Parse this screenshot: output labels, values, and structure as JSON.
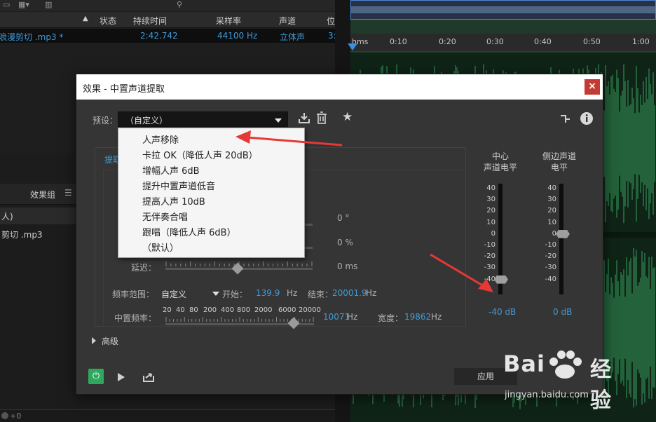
{
  "files_panel": {
    "columns": [
      "状态",
      "持续时间",
      "采样率",
      "声道",
      "位"
    ],
    "file_row": {
      "name": "浪漫剪切 .mp3 *",
      "duration": "2:42.742",
      "sample_rate": "44100 Hz",
      "channels": "立体声",
      "bits": "3:"
    },
    "effects_tab": "效果组",
    "rack_rows": [
      "人)",
      "剪切 .mp3"
    ],
    "bottom_value": "+0"
  },
  "timeline": {
    "ruler_labels": [
      "hms",
      "0:10",
      "0:20",
      "0:30",
      "0:40",
      "0:50",
      "1:00"
    ]
  },
  "dialog": {
    "title": "效果 - 中置声道提取",
    "close_label": "×",
    "preset_label": "预设：",
    "preset_value": "（自定义）",
    "preset_options": [
      "人声移除",
      "卡拉 OK（降低人声 20dB）",
      "增幅人声 6dB",
      "提升中置声道低音",
      "提高人声 10dB",
      "无伴奏合唱",
      "跟唱（降低人声 6dB）",
      "（默认）"
    ],
    "tab_label": "提取",
    "rows": {
      "phase_value": "0 °",
      "pan_value": "0 %",
      "delay_label": "延迟：",
      "delay_value": "0 ms",
      "freq_range_label": "频率范围：",
      "freq_range_value": "自定义",
      "start_label": "开始：",
      "start_value": "139.9",
      "start_unit": "Hz",
      "end_label": "结束：",
      "end_value": "20001.9",
      "end_unit": "Hz",
      "center_freq_label": "中置频率：",
      "center_freq_value": "10071",
      "center_freq_unit": "Hz",
      "width_label": "宽度：",
      "width_value": "19862",
      "width_unit": "Hz",
      "freq_scale": [
        "20",
        "40",
        "80",
        "200",
        "400",
        "800",
        "2000",
        "6000",
        "20000"
      ]
    },
    "meters": {
      "center": {
        "title_line1": "中心",
        "title_line2": "声道电平",
        "value": "-40 dB",
        "level_db": -40
      },
      "side": {
        "title_line1": "侧边声道",
        "title_line2": "电平",
        "value": "0 dB",
        "level_db": 0
      },
      "scale": [
        "40",
        "30",
        "20",
        "10",
        "0",
        "-10",
        "-20",
        "-30",
        "-40"
      ]
    },
    "advanced_label": "高级",
    "apply_label": "应用"
  },
  "watermark": {
    "brand": "Bai",
    "brand2": "经验",
    "url": "jingyan.baidu.com"
  },
  "colors": {
    "accent_blue": "#3f9bd8",
    "close_red": "#c33b33",
    "power_green": "#2fa85e",
    "annotation_red": "#e53935",
    "waveform_green": "#2d7d4c"
  }
}
